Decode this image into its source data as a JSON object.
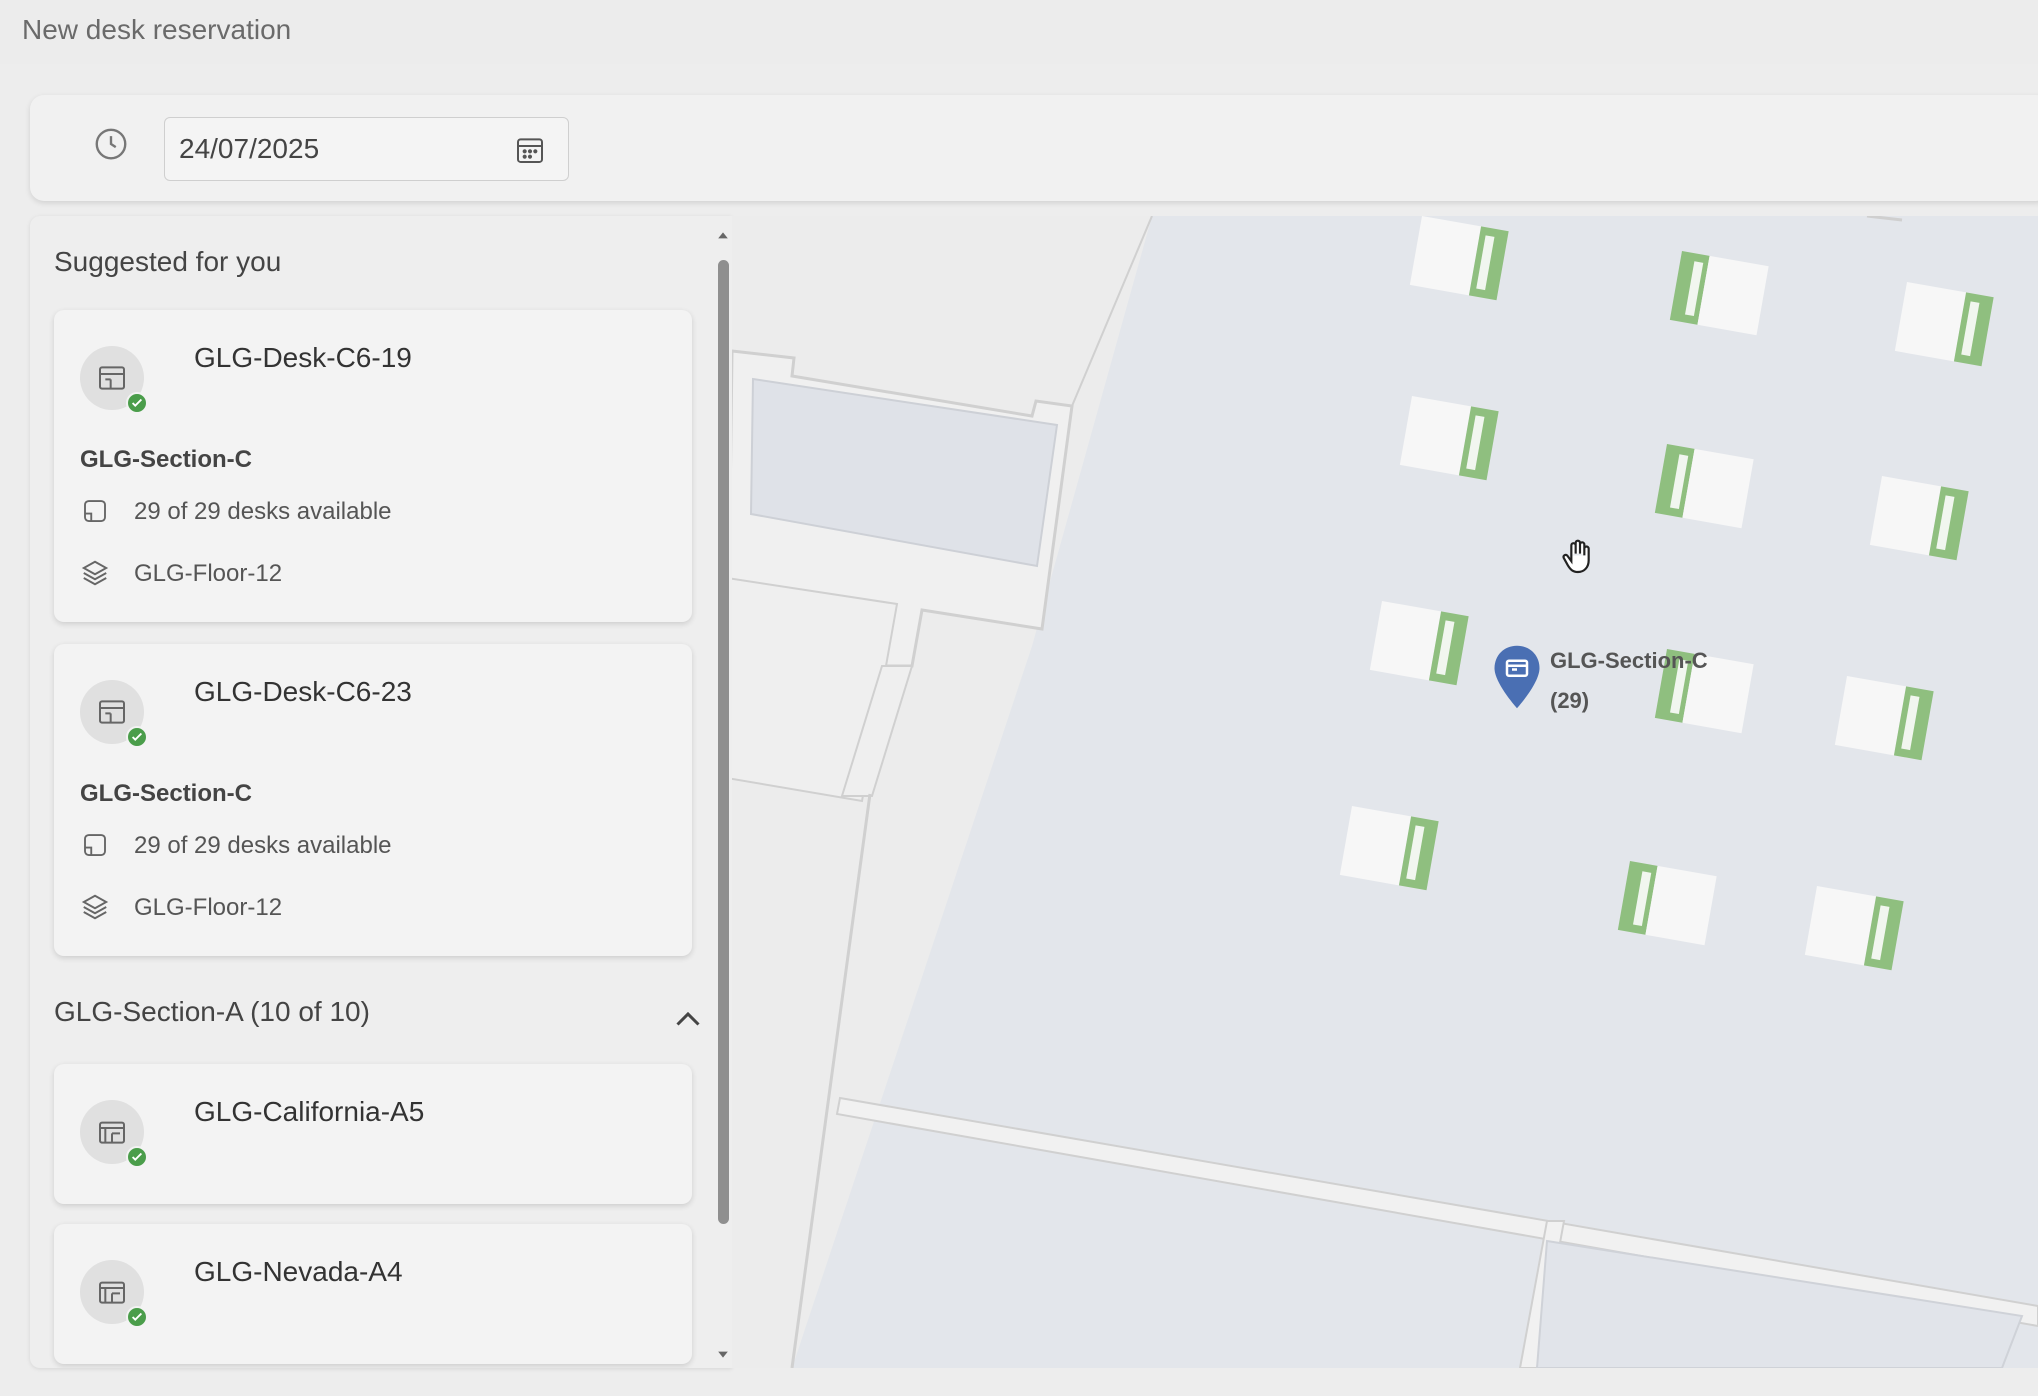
{
  "page": {
    "title": "New desk reservation"
  },
  "toolbar": {
    "date_value": "24/07/2025",
    "clock_icon": "clock-icon",
    "calendar_icon": "calendar-icon"
  },
  "suggested": {
    "heading": "Suggested for you",
    "cards": [
      {
        "title": "GLG-Desk-C6-19",
        "section": "GLG-Section-C",
        "availability": "29 of 29 desks available",
        "floor": "GLG-Floor-12"
      },
      {
        "title": "GLG-Desk-C6-23",
        "section": "GLG-Section-C",
        "availability": "29 of 29 desks available",
        "floor": "GLG-Floor-12"
      }
    ]
  },
  "section_a": {
    "heading": "GLG-Section-A (10 of 10)",
    "cards": [
      {
        "title": "GLG-California-A5"
      },
      {
        "title": "GLG-Nevada-A4"
      }
    ]
  },
  "map": {
    "pin_label": "GLG-Section-C",
    "pin_count": "(29)",
    "pin_color": "#4a6fb3",
    "desk_accent": "#8fbf7f"
  },
  "colors": {
    "available_check": "#4a9d4a"
  }
}
